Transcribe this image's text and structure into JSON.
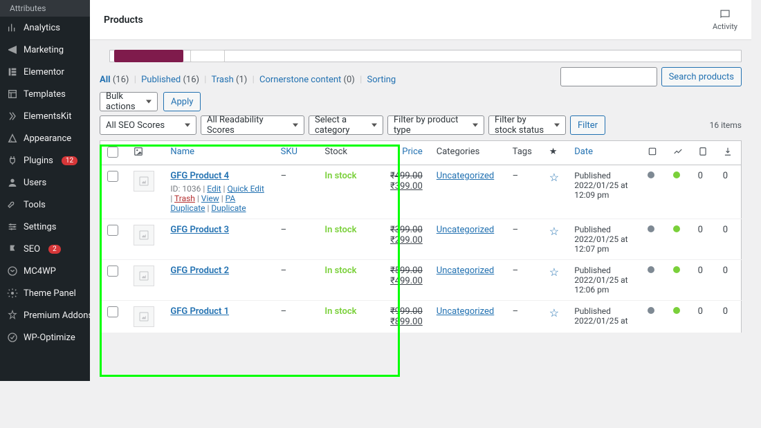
{
  "sidebar": {
    "sub": "Attributes",
    "items": [
      {
        "label": "Analytics",
        "k": "analytics"
      },
      {
        "label": "Marketing",
        "k": "marketing"
      },
      {
        "label": "Elementor",
        "k": "elementor"
      },
      {
        "label": "Templates",
        "k": "templates"
      },
      {
        "label": "ElementsKit",
        "k": "elementskit"
      },
      {
        "label": "Appearance",
        "k": "appearance"
      },
      {
        "label": "Plugins",
        "k": "plugins",
        "badge": "12"
      },
      {
        "label": "Users",
        "k": "users"
      },
      {
        "label": "Tools",
        "k": "tools"
      },
      {
        "label": "Settings",
        "k": "settings"
      },
      {
        "label": "SEO",
        "k": "seo",
        "badge": "2"
      },
      {
        "label": "MC4WP",
        "k": "mc4wp"
      },
      {
        "label": "Theme Panel",
        "k": "theme-panel"
      },
      {
        "label": "Premium Addons for Elementor",
        "k": "premium-addons"
      },
      {
        "label": "WP-Optimize",
        "k": "wp-optimize"
      }
    ]
  },
  "header": {
    "title": "Products",
    "activity": "Activity"
  },
  "filters": {
    "all": "All",
    "all_cnt": "(16)",
    "published": "Published",
    "published_cnt": "(16)",
    "trash": "Trash",
    "trash_cnt": "(1)",
    "cornerstone": "Cornerstone content",
    "cornerstone_cnt": "(0)",
    "sorting": "Sorting"
  },
  "bulk": {
    "label": "Bulk actions",
    "apply": "Apply"
  },
  "search": {
    "btn": "Search products"
  },
  "filter2": {
    "seo": "All SEO Scores",
    "read": "All Readability Scores",
    "cat": "Select a category",
    "type": "Filter by product type",
    "stock": "Filter by stock status",
    "btn": "Filter",
    "count": "16 items"
  },
  "cols": {
    "name": "Name",
    "sku": "SKU",
    "stock": "Stock",
    "price": "Price",
    "categories": "Categories",
    "tags": "Tags",
    "date": "Date"
  },
  "rows": [
    {
      "name": "GFG Product 4",
      "sku": "–",
      "stock": "In stock",
      "price_old": "₹499.00",
      "price_new": "₹399.00",
      "cat": "Uncategorized",
      "tags": "–",
      "date_pre": "Published",
      "date": "2022/01/25 at 12:09 pm",
      "c3": "0",
      "c4": "0",
      "id": "ID: 1036",
      "actions": {
        "edit": "Edit",
        "quick": "Quick Edit",
        "trash": "Trash",
        "view": "View",
        "pa": "PA Duplicate",
        "dup": "Duplicate"
      }
    },
    {
      "name": "GFG Product 3",
      "sku": "–",
      "stock": "In stock",
      "price_old": "₹399.00",
      "price_new": "₹299.00",
      "cat": "Uncategorized",
      "tags": "–",
      "date_pre": "Published",
      "date": "2022/01/25 at 12:07 pm",
      "c3": "0",
      "c4": "0"
    },
    {
      "name": "GFG Product 2",
      "sku": "–",
      "stock": "In stock",
      "price_old": "₹599.00",
      "price_new": "₹499.00",
      "cat": "Uncategorized",
      "tags": "–",
      "date_pre": "Published",
      "date": "2022/01/25 at 12:06 pm",
      "c3": "0",
      "c4": "0"
    },
    {
      "name": "GFG Product 1",
      "sku": "–",
      "stock": "In stock",
      "price_old": "₹999.00",
      "price_new": "₹899.00",
      "cat": "Uncategorized",
      "tags": "–",
      "date_pre": "Published",
      "date": "2022/01/25 at",
      "c3": "0",
      "c4": "0"
    }
  ]
}
